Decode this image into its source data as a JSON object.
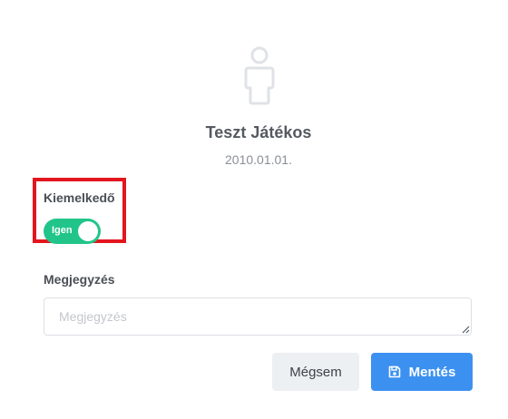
{
  "player": {
    "name": "Teszt Játékos",
    "date": "2010.01.01.",
    "avatar_icon": "user-outline-icon"
  },
  "featured": {
    "label": "Kiemelkedő",
    "toggle_text": "Igen",
    "toggle_on": true
  },
  "note": {
    "label": "Megjegyzés",
    "value": "",
    "placeholder": "Megjegyzés"
  },
  "actions": {
    "cancel_label": "Mégsem",
    "save_label": "Mentés",
    "save_icon": "save-icon"
  },
  "colors": {
    "toggle_on": "#22c589",
    "primary": "#3c91f0",
    "highlight": "#e3161e"
  }
}
